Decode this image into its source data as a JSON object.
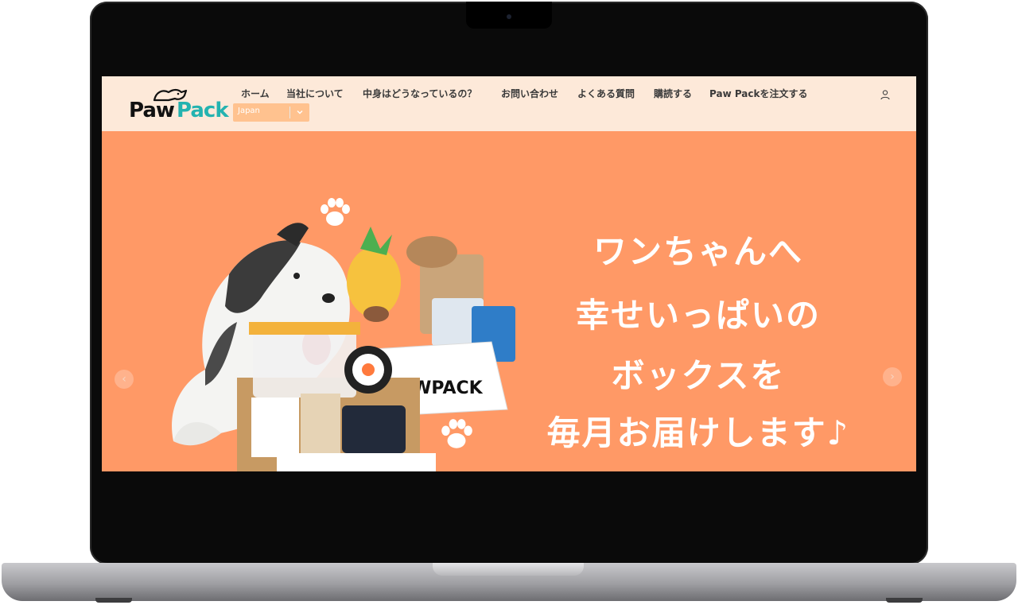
{
  "site": {
    "logo": {
      "part1": "Paw",
      "part2": "Pack"
    },
    "nav": {
      "items": [
        {
          "label": "ホーム"
        },
        {
          "label": "当社について"
        },
        {
          "label": "中身はどうなっているの？"
        },
        {
          "label": "お問い合わせ"
        },
        {
          "label": "よくある質問"
        },
        {
          "label": "購読する"
        },
        {
          "label": "Paw Packを注文する"
        }
      ]
    },
    "country_select": {
      "value": "Japan"
    },
    "hero": {
      "lines": [
        "ワンちゃんへ",
        "幸せいっぱいの",
        "ボックスを",
        "毎月お届けします♪"
      ],
      "box_label": "PAWPACK",
      "prev_arrow": "‹",
      "next_arrow": "›"
    },
    "colors": {
      "header_bg": "#fde9d9",
      "hero_bg": "#ff9966",
      "brand_teal": "#24b3b0",
      "select_bg": "#ffc28f"
    },
    "icons": [
      "user-icon",
      "chevron-down-icon",
      "paw-icon",
      "chevron-left-icon",
      "chevron-right-icon"
    ]
  }
}
